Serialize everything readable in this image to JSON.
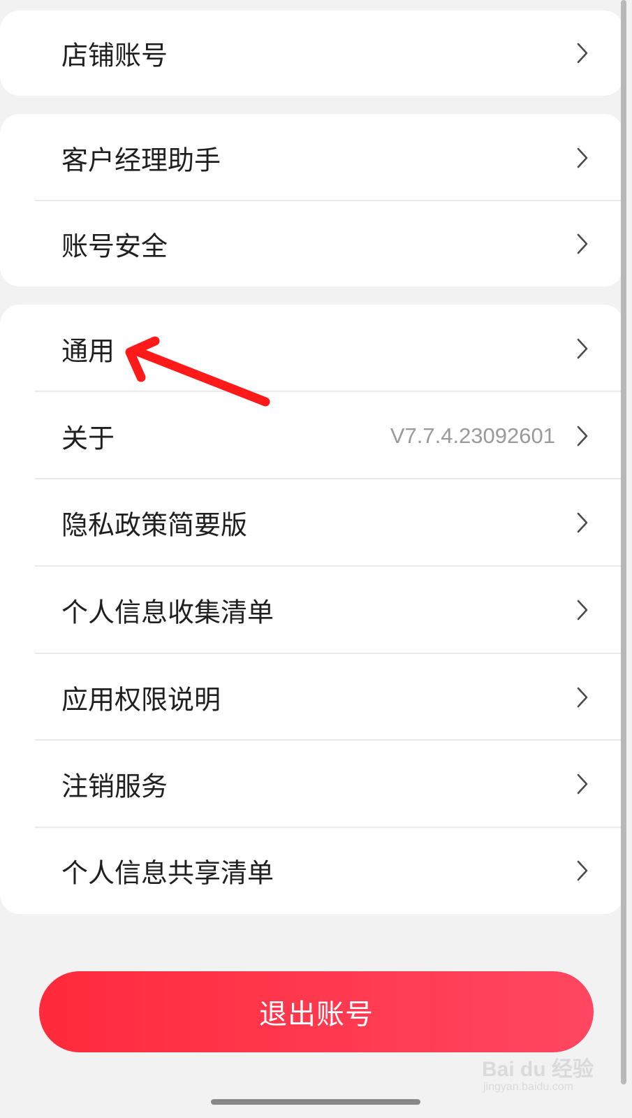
{
  "groups": [
    {
      "items": [
        {
          "label": "店铺账号",
          "value": ""
        }
      ]
    },
    {
      "items": [
        {
          "label": "客户经理助手",
          "value": ""
        },
        {
          "label": "账号安全",
          "value": ""
        }
      ]
    },
    {
      "items": [
        {
          "label": "通用",
          "value": ""
        },
        {
          "label": "关于",
          "value": "V7.7.4.23092601"
        },
        {
          "label": "隐私政策简要版",
          "value": ""
        },
        {
          "label": "个人信息收集清单",
          "value": ""
        },
        {
          "label": "应用权限说明",
          "value": ""
        },
        {
          "label": "注销服务",
          "value": ""
        },
        {
          "label": "个人信息共享清单",
          "value": ""
        }
      ]
    }
  ],
  "logout": {
    "label": "退出账号"
  },
  "annotation": {
    "color": "#ff1a1a",
    "icon": "red-arrow-annotation"
  },
  "watermark": {
    "text": "Bai du 经验",
    "sub": "jingyan.baidu.com"
  },
  "colors": {
    "background": "#f2f2f2",
    "card": "#ffffff",
    "accent": "#ff2a3b",
    "value_text": "#9a9a9a"
  }
}
